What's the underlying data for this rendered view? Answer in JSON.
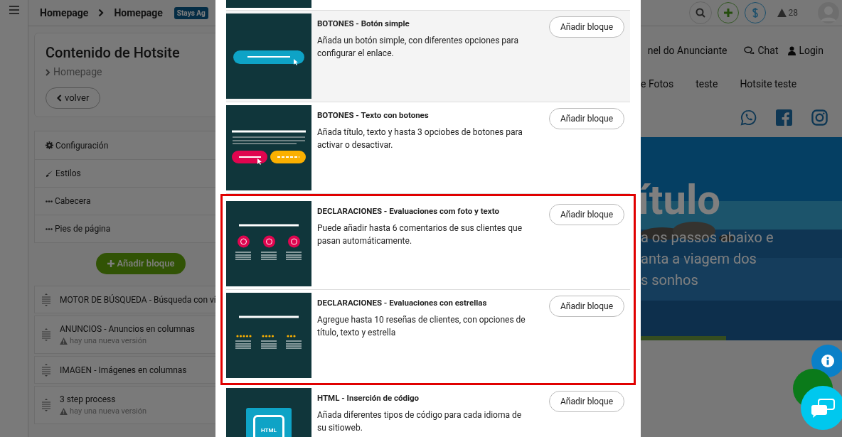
{
  "topbar": {
    "crumbs": [
      "Homepage",
      "Homepage"
    ],
    "badge": "Stays Ag",
    "alerts": "28"
  },
  "panel": {
    "title": "Contenido de Hotsite",
    "path": "Homepage",
    "back": "volver",
    "menu": [
      {
        "label": "Configuración"
      },
      {
        "label": "Estilos"
      },
      {
        "label": "Cabecera"
      },
      {
        "label": "Pies de página"
      }
    ],
    "add_button": "Añadir bloque",
    "blocks": [
      {
        "title": "MOTOR DE BÚSQUEDA - Búsqueda con ví"
      },
      {
        "title": "ANUNCIOS - Anuncios en columnas",
        "warning": "hay una nueva versión"
      },
      {
        "title": "IMAGEN - Imágenes en columnas"
      },
      {
        "title": "3 step process",
        "warning": "hay una nueva versión"
      }
    ]
  },
  "preview": {
    "links": [
      {
        "label": "nel do Anunciante"
      },
      {
        "label": "Chat"
      },
      {
        "label": "Login"
      }
    ],
    "nav": [
      "e Fotos",
      "teste",
      "Hotsite teste"
    ],
    "hero": {
      "kind": "picture",
      "title": "ítulo",
      "lines": [
        "a os passos abaixo e",
        "anta a viagem dos",
        "s sonhos"
      ]
    }
  },
  "modal": {
    "items": [
      {
        "kind": "button",
        "title": "BOTONES - Botón simple",
        "description": "Añada un botón simple, con diferentes opciones para configurar el enlace.",
        "button": "Añadir bloque",
        "highlighted": true,
        "outlined": false
      },
      {
        "kind": "text-buttons",
        "title": "BOTONES - Texto con botones",
        "description": "Añada título, texto y hasta 3 opciobes de botones para activar o desactivar.",
        "button": "Añadir bloque",
        "highlighted": false,
        "outlined": false
      },
      {
        "kind": "photo-reviews",
        "title": "DECLARACIONES - Evaluaciones com foto y texto",
        "description": "Puede añadir hasta 6 comentarios de sus clientes que pasan automáticamente.",
        "button": "Añadir bloque",
        "highlighted": false,
        "outlined": true
      },
      {
        "kind": "star-reviews",
        "title": "DECLARACIONES - Evaluaciones con estrellas",
        "description": "Agregue hasta 10 reseñas de clientes, con opciones de título, texto y estrella",
        "button": "Añadir bloque",
        "highlighted": false,
        "outlined": true
      },
      {
        "kind": "html",
        "title": "HTML - Inserción de código",
        "description": "Añada diferentes tipos de código para cada idioma de su sitioweb.",
        "button": "Añadir bloque",
        "highlighted": false,
        "outlined": false,
        "thumb_label": "HTML"
      }
    ]
  }
}
